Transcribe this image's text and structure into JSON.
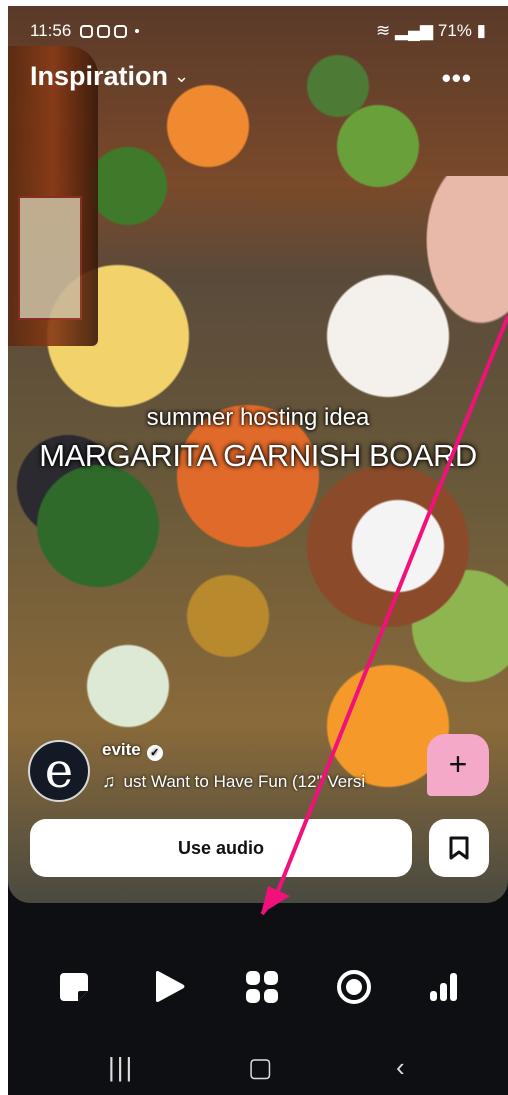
{
  "status_bar": {
    "time": "11:56",
    "battery": "71%"
  },
  "header": {
    "title": "Inspiration"
  },
  "overlay": {
    "line1": "summer hosting idea",
    "line2": "MARGARITA GARNISH BOARD"
  },
  "post": {
    "author": "evite",
    "avatar_letter": "e",
    "audio_title": "ust Want to Have Fun (12\" Versi"
  },
  "actions": {
    "use_audio_label": "Use audio"
  },
  "colors": {
    "accent_pink": "#f4a9c9",
    "arrow": "#f0117a",
    "nav_bg": "#0d0f12"
  },
  "icons": {
    "save": "bookmark-icon",
    "create": "plus-icon"
  }
}
